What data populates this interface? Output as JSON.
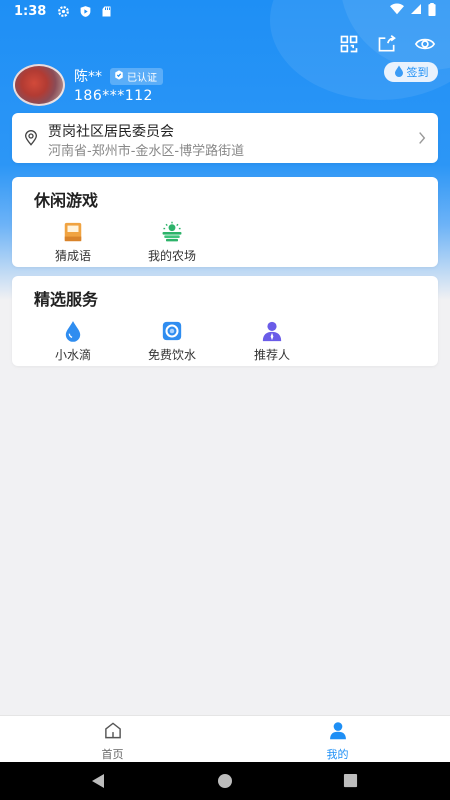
{
  "status_bar": {
    "time": "1:38"
  },
  "header": {
    "actions": [
      "qrcode-icon",
      "share-icon",
      "eye-icon"
    ]
  },
  "user": {
    "name": "陈**",
    "verified_label": "已认证",
    "phone": "186***112",
    "signin_label": "签到"
  },
  "community": {
    "name": "贾岗社区居民委员会",
    "address": "河南省-郑州市-金水区-博学路街道"
  },
  "games": {
    "title": "休闲游戏",
    "items": [
      {
        "label": "猜成语",
        "icon": "idiom-book-icon"
      },
      {
        "label": "我的农场",
        "icon": "farm-icon"
      }
    ]
  },
  "services": {
    "title": "精选服务",
    "items": [
      {
        "label": "小水滴",
        "icon": "water-drop-icon"
      },
      {
        "label": "免费饮水",
        "icon": "water-dispenser-icon"
      },
      {
        "label": "推荐人",
        "icon": "referrer-person-icon"
      }
    ]
  },
  "tabbar": {
    "tabs": [
      {
        "label": "首页",
        "icon": "home-icon",
        "active": false
      },
      {
        "label": "我的",
        "icon": "profile-icon",
        "active": true
      }
    ],
    "active_color": "#1e8ff5",
    "inactive_color": "#666666"
  },
  "colors": {
    "primary": "#1e8ff5",
    "background": "#f1f1f3"
  }
}
